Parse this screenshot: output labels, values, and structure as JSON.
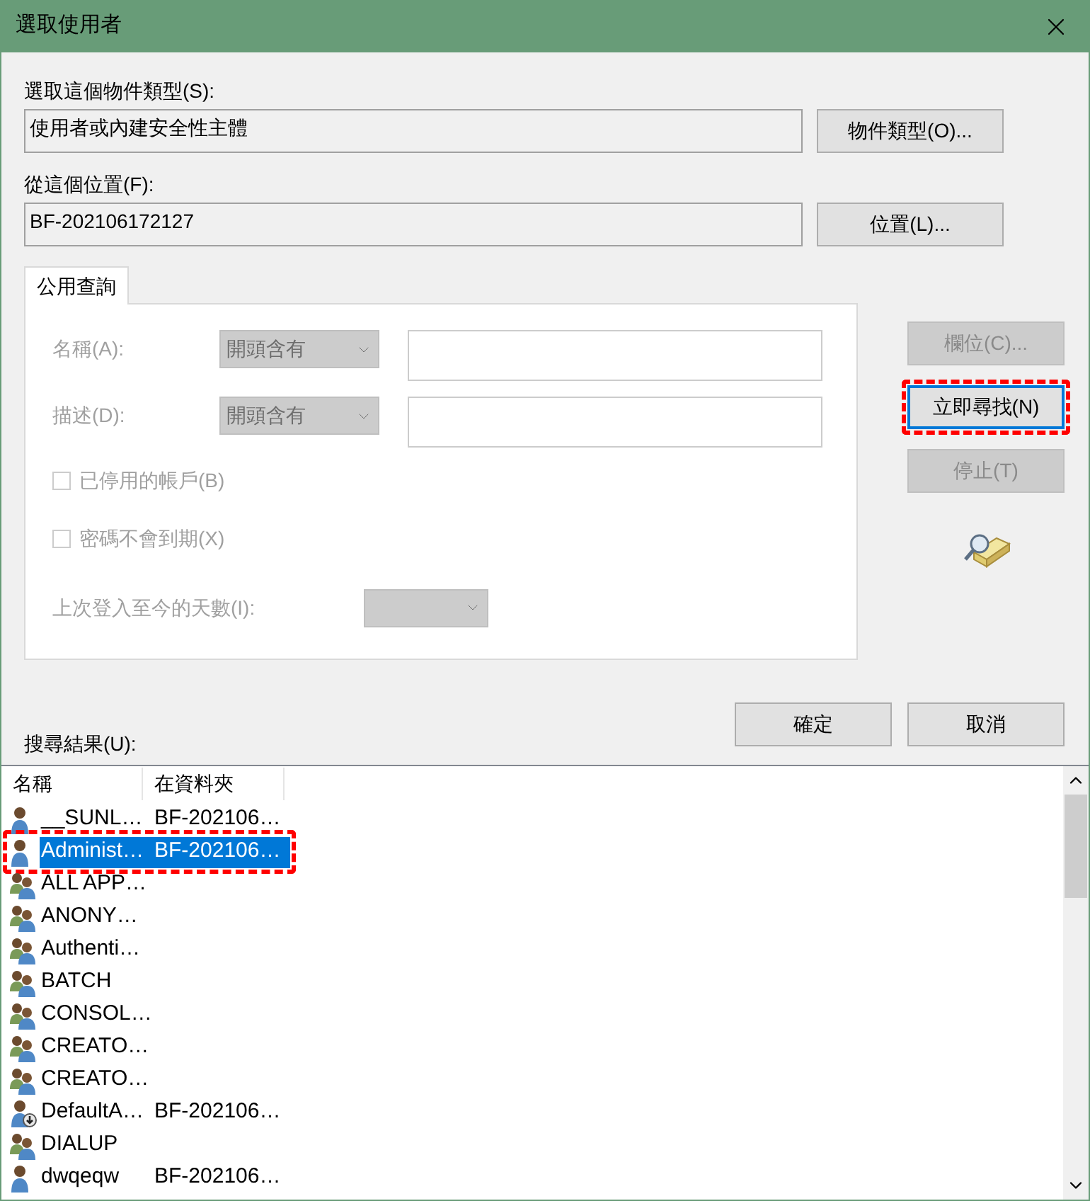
{
  "window": {
    "title": "選取使用者"
  },
  "object_type": {
    "label": "選取這個物件類型(S):",
    "value": "使用者或內建安全性主體",
    "button": "物件類型(O)..."
  },
  "location": {
    "label": "從這個位置(F):",
    "value": "BF-202106172127",
    "button": "位置(L)..."
  },
  "tabs": [
    {
      "label": "公用查詢",
      "selected": true
    }
  ],
  "query": {
    "fields": [
      {
        "kind": "text-filter",
        "label": "名稱(A):",
        "mode": "開頭含有",
        "disabled": true
      },
      {
        "kind": "text-filter",
        "label": "描述(D):",
        "mode": "開頭含有",
        "disabled": true
      },
      {
        "kind": "checkbox",
        "label": "已停用的帳戶(B)",
        "checked": false,
        "disabled": true
      },
      {
        "kind": "checkbox",
        "label": "密碼不會到期(X)",
        "checked": false,
        "disabled": true
      },
      {
        "kind": "days",
        "label": "上次登入至今的天數(I):",
        "disabled": true
      }
    ]
  },
  "side_buttons": [
    {
      "label": "欄位(C)...",
      "disabled": true,
      "focused": false,
      "annotated": false
    },
    {
      "label": "立即尋找(N)",
      "disabled": false,
      "focused": true,
      "annotated": true
    },
    {
      "label": "停止(T)",
      "disabled": true,
      "focused": false,
      "annotated": false
    }
  ],
  "dialog_buttons": [
    "確定",
    "取消"
  ],
  "results": {
    "label": "搜尋結果(U):",
    "columns": [
      "名稱",
      "在資料夾"
    ],
    "rows": [
      {
        "kind": "user",
        "name": "__SUNL…",
        "folder": "BF-202106…",
        "selected": false,
        "annotated": false
      },
      {
        "kind": "user",
        "name": "Administ…",
        "folder": "BF-202106…",
        "selected": true,
        "annotated": true
      },
      {
        "kind": "group",
        "name": "ALL APP…",
        "selected": false,
        "annotated": false
      },
      {
        "kind": "group",
        "name": "ANONY…",
        "selected": false,
        "annotated": false
      },
      {
        "kind": "group",
        "name": "Authenti…",
        "selected": false,
        "annotated": false
      },
      {
        "kind": "group",
        "name": "BATCH",
        "selected": false,
        "annotated": false
      },
      {
        "kind": "group",
        "name": "CONSOL…",
        "selected": false,
        "annotated": false
      },
      {
        "kind": "group",
        "name": "CREATO…",
        "selected": false,
        "annotated": false
      },
      {
        "kind": "group",
        "name": "CREATO…",
        "selected": false,
        "annotated": false
      },
      {
        "kind": "user-download",
        "name": "DefaultA…",
        "folder": "BF-202106…",
        "selected": false,
        "annotated": false
      },
      {
        "kind": "group",
        "name": "DIALUP",
        "selected": false,
        "annotated": false
      },
      {
        "kind": "user",
        "name": "dwqeqw",
        "folder": "BF-202106…",
        "selected": false,
        "annotated": false
      }
    ]
  }
}
